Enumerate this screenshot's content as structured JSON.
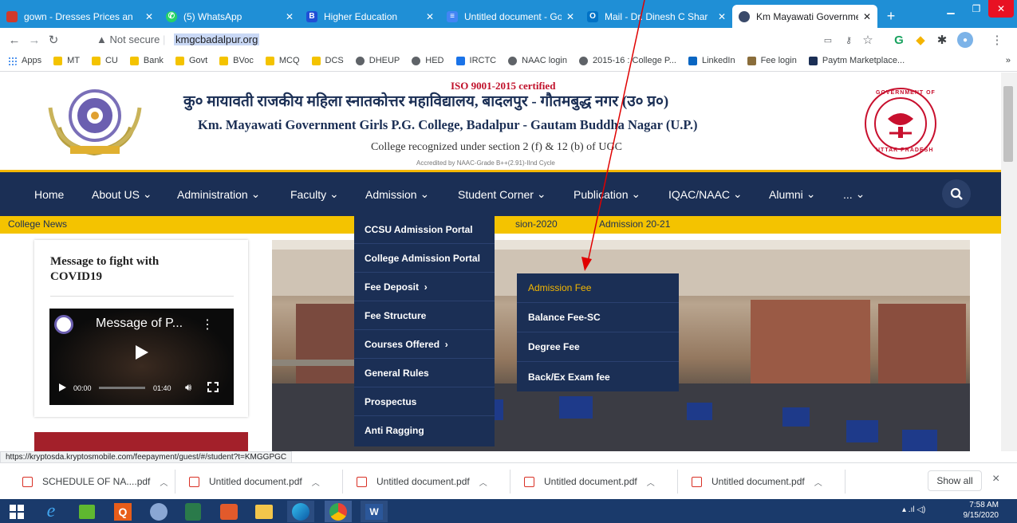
{
  "browser": {
    "tabs": [
      {
        "title": "gown - Dresses Prices an",
        "icon": "gown-favicon-icon"
      },
      {
        "title": "(5) WhatsApp",
        "icon": "whatsapp-icon"
      },
      {
        "title": "Higher Education",
        "icon": "b-favicon-icon"
      },
      {
        "title": "Untitled document - Go",
        "icon": "google-docs-icon"
      },
      {
        "title": "Mail - Dr. Dinesh C Shar",
        "icon": "outlook-icon"
      },
      {
        "title": "Km Mayawati Governme",
        "icon": "site-favicon-icon",
        "active": true
      }
    ],
    "new_tab": "+",
    "url_prefix": "Not secure",
    "url": "kmgcbadalpur.org",
    "bookmarks": [
      {
        "label": "Apps",
        "color": "#1a73e8"
      },
      {
        "label": "MT",
        "color": "#f4c300"
      },
      {
        "label": "CU",
        "color": "#f4c300"
      },
      {
        "label": "Bank",
        "color": "#f4c300"
      },
      {
        "label": "Govt",
        "color": "#f4c300"
      },
      {
        "label": "BVoc",
        "color": "#f4c300"
      },
      {
        "label": "MCQ",
        "color": "#f4c300"
      },
      {
        "label": "DCS",
        "color": "#f4c300"
      },
      {
        "label": "DHEUP",
        "color": "#5f6368"
      },
      {
        "label": "HED",
        "color": "#5f6368"
      },
      {
        "label": "IRCTC",
        "color": "#1a73e8"
      },
      {
        "label": "NAAC login",
        "color": "#5f6368"
      },
      {
        "label": "2015-16 : College P...",
        "color": "#5f6368"
      },
      {
        "label": "LinkedIn",
        "color": "#0a66c2"
      },
      {
        "label": "Fee login",
        "color": "#8a6d3b"
      },
      {
        "label": "Paytm Marketplace...",
        "color": "#1b2f55"
      }
    ],
    "bookmarks_more": "»"
  },
  "site": {
    "iso": "ISO 9001-2015 certified",
    "title_hindi": "कु० मायावती राजकीय महिला स्नातकोत्तर महाविद्यालय, बादलपुर - गौतमबुद्ध नगर (उ० प्र०)",
    "title_english": "Km. Mayawati Government Girls P.G. College, Badalpur - Gautam Buddha Nagar (U.P.)",
    "recognized": "College recognized under section 2 (f) & 12 (b) of UGC",
    "accredited": "Accredited by NAAC-Grade B++(2.91)-IInd Cycle",
    "seal_top": "GOVERNMENT OF",
    "seal_bottom": "UTTAR PRADESH",
    "nav": [
      {
        "label": "Home",
        "chev": ""
      },
      {
        "label": "About US",
        "chev": "⌄"
      },
      {
        "label": "Administration",
        "chev": "⌄"
      },
      {
        "label": "Faculty",
        "chev": "⌄"
      },
      {
        "label": "Admission",
        "chev": "⌄"
      },
      {
        "label": "Student Corner",
        "chev": "⌄"
      },
      {
        "label": "Publication",
        "chev": "⌄"
      },
      {
        "label": "IQAC/NAAC",
        "chev": "⌄"
      },
      {
        "label": "Alumni",
        "chev": "⌄"
      },
      {
        "label": "...",
        "chev": "⌄"
      }
    ],
    "news_label": "College News",
    "news_items": [
      "sion-2020",
      "Admission 20-21"
    ],
    "sidebar_title": "Message to fight with COVID19",
    "video": {
      "title": "Message of P...",
      "menu": "⋮",
      "current": "00:00",
      "duration": "01:40"
    },
    "admission_menu": [
      {
        "label": "CCSU Admission Portal",
        "arrow": ""
      },
      {
        "label": "College Admission Portal",
        "arrow": ""
      },
      {
        "label": "Fee Deposit",
        "arrow": "›"
      },
      {
        "label": "Fee Structure",
        "arrow": ""
      },
      {
        "label": "Courses Offered",
        "arrow": "›"
      },
      {
        "label": "General Rules",
        "arrow": ""
      },
      {
        "label": "Prospectus",
        "arrow": ""
      },
      {
        "label": "Anti Ragging",
        "arrow": ""
      }
    ],
    "fee_submenu": [
      {
        "label": "Admission Fee",
        "highlight": true
      },
      {
        "label": "Balance Fee-SC"
      },
      {
        "label": "Degree Fee"
      },
      {
        "label": "Back/Ex Exam fee"
      }
    ],
    "highlight_color": "#f4b700",
    "nav_color": "#1b2f55",
    "annotation_color": "#e00000"
  },
  "status_url": "https://kryptosda.kryptosmobile.com/feepayment/guest/#/student?t=KMGGPGC",
  "downloads": {
    "files": [
      "SCHEDULE OF NA....pdf",
      "Untitled document.pdf",
      "Untitled document.pdf",
      "Untitled document.pdf",
      "Untitled document.pdf"
    ],
    "show_all": "Show all",
    "close": "×"
  },
  "taskbar": {
    "time": "7:58 AM",
    "date": "9/15/2020"
  }
}
